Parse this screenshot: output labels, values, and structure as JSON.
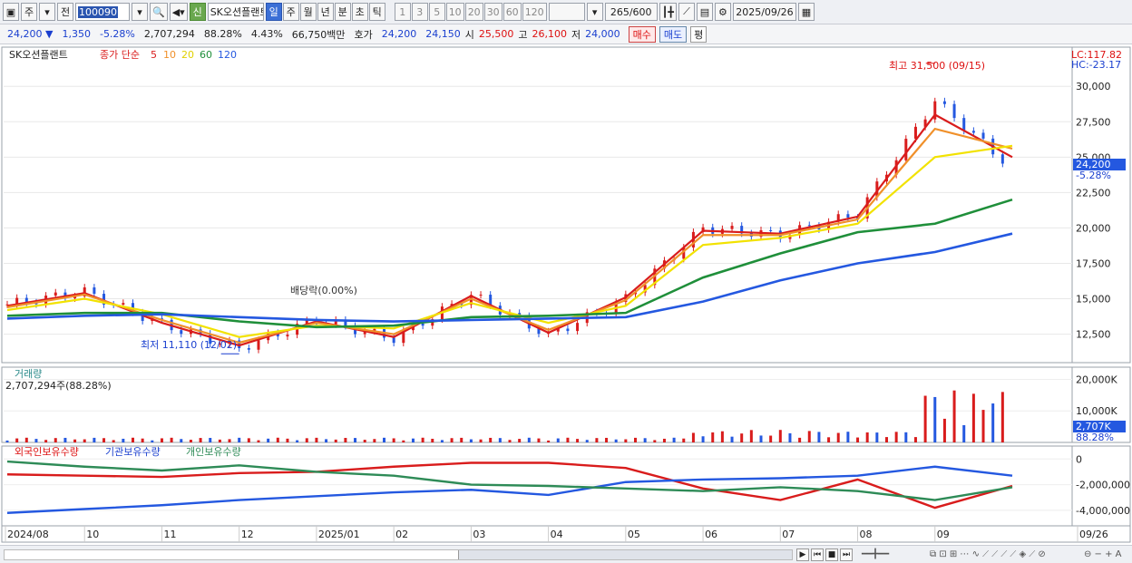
{
  "toolbar": {
    "period_type": "주",
    "prev_label": "전",
    "code": "100090",
    "news_label": "신",
    "stock_name": "SK오션플랜트",
    "period_tabs": [
      "일",
      "주",
      "월",
      "년",
      "분",
      "초",
      "틱"
    ],
    "active_tab": "일",
    "interval_tabs": [
      "1",
      "3",
      "5",
      "10",
      "20",
      "30",
      "60",
      "120"
    ],
    "count_label": "265",
    "count_total": "/600",
    "date": "2025/09/26"
  },
  "quote": {
    "price": "24,200",
    "change": "1,350",
    "change_pct": "-5.28%",
    "volume": "2,707,294",
    "vol_ratio": "88.28%",
    "turnover": "4.43%",
    "amount": "66,750백만",
    "bid_label": "호가",
    "ask": "24,200",
    "bid": "24,150",
    "open_label": "시",
    "open": "25,500",
    "high_label": "고",
    "high": "26,100",
    "low_label": "저",
    "low": "24,000",
    "buy_label": "매수",
    "sell_label": "매도",
    "eval_label": "평"
  },
  "price_panel": {
    "stock_label": "SK오션플랜트",
    "ma_title": "종가 단순",
    "ma_periods": [
      "5",
      "10",
      "20",
      "60",
      "120"
    ],
    "ma_colors": [
      "#d91c1c",
      "#f0902a",
      "#f2e200",
      "#1f8f3a",
      "#2458e0"
    ],
    "lc_label": "LC:117.82",
    "hc_label": "HC:-23.17",
    "y_ticks": [
      "30,000",
      "27,500",
      "25,000",
      "22,500",
      "20,000",
      "17,500",
      "15,000",
      "12,500"
    ],
    "current_price": "24,200",
    "current_pct": "-5.28%",
    "high_annotation": "최고 31,500 (09/15)",
    "low_annotation": "최저 11,110 (12/02)",
    "dividend_annotation": "배당락(0.00%)"
  },
  "volume_panel": {
    "title": "거래량",
    "value_label": "2,707,294주(88.28%)",
    "y_ticks": [
      "20,000K",
      "10,000K"
    ],
    "current": "2,707K",
    "current_pct": "88.28%"
  },
  "holdings_panel": {
    "series_labels": [
      "외국인보유수량",
      "기관보유수량",
      "개인보유수량"
    ],
    "series_colors": [
      "#d91c1c",
      "#2458e0",
      "#2e8b57"
    ],
    "y_ticks": [
      "0",
      "-2,000,000",
      "-4,000,000"
    ]
  },
  "x_axis": {
    "labels": [
      "2024/08",
      "10",
      "11",
      "12",
      "2025/01",
      "02",
      "03",
      "04",
      "05",
      "06",
      "07",
      "08",
      "09",
      "09/26"
    ]
  },
  "chart_data": {
    "type": "line",
    "title": "SK오션플랜트",
    "categories": [
      "2024/08",
      "10",
      "11",
      "12",
      "2025/01",
      "02",
      "03",
      "04",
      "05",
      "06",
      "07",
      "08",
      "09",
      "09/26"
    ],
    "series": [
      {
        "name": "종가",
        "values": [
          14600,
          15500,
          13200,
          11500,
          13500,
          12200,
          15300,
          12400,
          15000,
          20000,
          19500,
          21000,
          29000,
          24200
        ]
      },
      {
        "name": "5",
        "values": [
          14500,
          15400,
          13300,
          11700,
          13400,
          12300,
          15200,
          12600,
          15100,
          19800,
          19600,
          20800,
          28000,
          25000
        ]
      },
      {
        "name": "10",
        "values": [
          14400,
          15300,
          13500,
          11900,
          13300,
          12500,
          15000,
          12800,
          14900,
          19500,
          19500,
          20600,
          27000,
          25600
        ]
      },
      {
        "name": "20",
        "values": [
          14200,
          15000,
          13900,
          12300,
          13100,
          12900,
          14700,
          13300,
          14500,
          18800,
          19300,
          20300,
          25000,
          25800
        ]
      },
      {
        "name": "60",
        "values": [
          13800,
          14000,
          14000,
          13400,
          13000,
          13100,
          13700,
          13800,
          14000,
          16500,
          18200,
          19700,
          20300,
          22000
        ]
      },
      {
        "name": "120",
        "values": [
          13600,
          13800,
          13900,
          13700,
          13500,
          13400,
          13500,
          13600,
          13700,
          14800,
          16300,
          17500,
          18300,
          19600
        ]
      }
    ],
    "ylim": [
      11000,
      32000
    ],
    "high": {
      "value": 31500,
      "date": "09/15"
    },
    "low": {
      "value": 11110,
      "date": "12/02"
    },
    "volume": {
      "current": 2707294,
      "ylim": [
        0,
        21000000
      ],
      "peak": 20000000
    },
    "holdings": {
      "categories": [
        "2024/08",
        "10",
        "11",
        "12",
        "2025/01",
        "02",
        "03",
        "04",
        "05",
        "06",
        "07",
        "08",
        "09",
        "09/26"
      ],
      "series": [
        {
          "name": "외국인보유수량",
          "values": [
            -1200000,
            -1300000,
            -1400000,
            -1100000,
            -1000000,
            -600000,
            -300000,
            -300000,
            -700000,
            -2300000,
            -3200000,
            -1600000,
            -3800000,
            -2100000
          ]
        },
        {
          "name": "기관보유수량",
          "values": [
            -4200000,
            -3900000,
            -3600000,
            -3200000,
            -2900000,
            -2600000,
            -2400000,
            -2800000,
            -1800000,
            -1600000,
            -1500000,
            -1300000,
            -600000,
            -1300000
          ]
        },
        {
          "name": "개인보유수량",
          "values": [
            -200000,
            -600000,
            -900000,
            -500000,
            -1000000,
            -1300000,
            -2000000,
            -2100000,
            -2300000,
            -2500000,
            -2200000,
            -2500000,
            -3200000,
            -2200000
          ]
        }
      ],
      "ylim": [
        -4500000,
        300000
      ]
    }
  }
}
